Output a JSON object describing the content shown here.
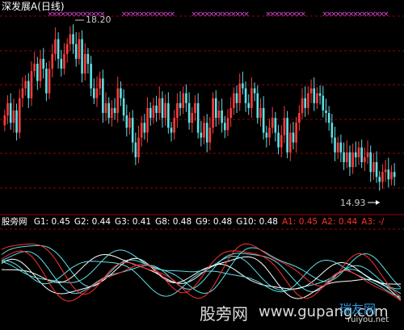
{
  "colors": {
    "background": "#000000",
    "grid": "#9a0000",
    "up": "#ff3b3b",
    "down": "#5fe0e6",
    "marker": "#e04ce0",
    "text": "#c8c8c8",
    "yellow": "#ffff00",
    "white": "#ffffff",
    "red": "#ff3030"
  },
  "title": "深发展A(日线)",
  "annotations": {
    "high": "18.20",
    "low": "14.93"
  },
  "indicator": {
    "name": "股旁网",
    "values": [
      {
        "label": "G1: 0.45",
        "color": "#ffffff"
      },
      {
        "label": "G2: 0.44",
        "color": "#ffffff"
      },
      {
        "label": "G3: 0.41",
        "color": "#ffffff"
      },
      {
        "label": "G8: 0.48",
        "color": "#ffffff"
      },
      {
        "label": "G9: 0.48",
        "color": "#ffffff"
      },
      {
        "label": "G10: 0.48",
        "color": "#ffffff"
      },
      {
        "label": "A1: 0.45",
        "color": "#ff3030"
      },
      {
        "label": "A2: 0.44",
        "color": "#ff3030"
      },
      {
        "label": "A3: -/",
        "color": "#ff3030"
      }
    ]
  },
  "watermark": {
    "left": "股旁网",
    "url": "www.gupang.com",
    "brand": "瑞友网",
    "brand_url": "ruiyou.net"
  },
  "chart_data": [
    {
      "type": "candlestick",
      "title": "深发展A(日线)",
      "ylim": [
        14.4,
        18.4
      ],
      "grid": true,
      "annotations": [
        {
          "text": "18.20",
          "x_index": 25
        },
        {
          "text": "14.93",
          "x_index": 126
        }
      ],
      "candles_close": [
        16.35,
        16.6,
        16.2,
        16.45,
        16.0,
        16.7,
        16.9,
        17.05,
        16.7,
        17.25,
        17.4,
        17.05,
        17.5,
        17.3,
        16.8,
        17.3,
        17.6,
        17.9,
        17.5,
        17.3,
        17.6,
        17.8,
        18.0,
        17.8,
        17.5,
        17.9,
        17.2,
        17.6,
        17.4,
        16.9,
        16.7,
        16.9,
        17.1,
        16.4,
        16.6,
        16.3,
        16.5,
        16.4,
        16.9,
        16.7,
        16.35,
        16.1,
        16.3,
        15.8,
        15.5,
        15.9,
        16.2,
        16.0,
        16.5,
        16.3,
        16.55,
        16.4,
        16.7,
        16.3,
        16.6,
        16.1,
        16.0,
        16.3,
        16.6,
        16.5,
        16.8,
        16.6,
        16.2,
        16.4,
        16.6,
        16.0,
        15.9,
        16.2,
        15.8,
        16.1,
        16.7,
        16.3,
        16.45,
        16.2,
        16.05,
        16.3,
        16.5,
        16.8,
        16.6,
        17.0,
        16.9,
        16.6,
        16.5,
        16.9,
        16.8,
        16.3,
        16.5,
        16.0,
        15.9,
        16.1,
        16.3,
        16.0,
        15.7,
        15.95,
        16.3,
        15.6,
        16.0,
        15.8,
        16.2,
        16.4,
        16.7,
        16.5,
        16.8,
        16.9,
        16.6,
        16.8,
        16.75,
        16.45,
        16.4,
        16.2,
        15.9,
        15.6,
        15.8,
        15.6,
        15.4,
        15.6,
        15.3,
        15.6,
        15.5,
        15.7,
        15.4,
        15.5,
        15.6,
        15.2,
        15.4,
        15.1,
        15.0,
        15.2,
        15.25,
        15.05,
        15.2,
        15.1
      ]
    },
    {
      "type": "line",
      "title": "股旁网",
      "ylim": [
        0,
        1
      ],
      "series": [
        {
          "name": "G1",
          "last": 0.45
        },
        {
          "name": "G2",
          "last": 0.44
        },
        {
          "name": "G3",
          "last": 0.41
        },
        {
          "name": "G8",
          "last": 0.48
        },
        {
          "name": "G9",
          "last": 0.48
        },
        {
          "name": "G10",
          "last": 0.48
        },
        {
          "name": "A1",
          "last": 0.45
        },
        {
          "name": "A2",
          "last": 0.44
        }
      ]
    }
  ]
}
